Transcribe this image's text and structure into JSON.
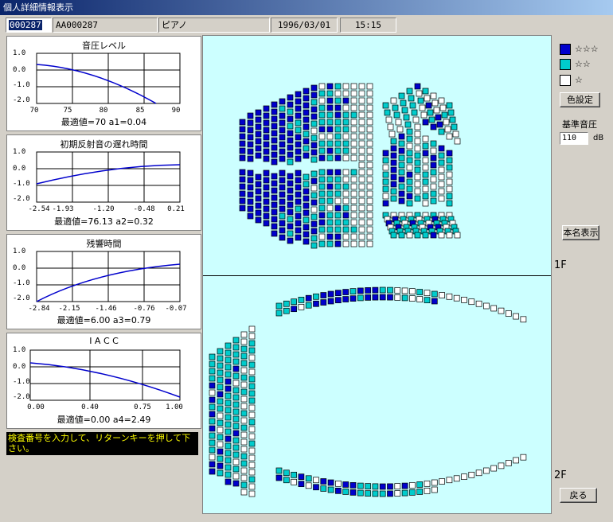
{
  "window": {
    "title": "個人詳細情報表示"
  },
  "header": {
    "exam_number": "000287",
    "id": "AA000287",
    "source": "ピアノ",
    "date": "1996/03/01",
    "time": "15:15"
  },
  "graphs": [
    {
      "title": "音圧レベル",
      "y_ticks": [
        "1.0",
        "0.0",
        "-1.0",
        "-2.0"
      ],
      "x_ticks": [
        "70",
        "75",
        "80",
        "85",
        "90"
      ],
      "footer": "最適値=70 a1=0.04"
    },
    {
      "title": "初期反射音の遅れ時間",
      "y_ticks": [
        "1.0",
        "0.0",
        "-1.0",
        "-2.0"
      ],
      "x_ticks": [
        "-2.54",
        "-1.93",
        "-1.20",
        "-0.48",
        "0.21"
      ],
      "footer": "最適値=76.13 a2=0.32"
    },
    {
      "title": "残響時間",
      "y_ticks": [
        "1.0",
        "0.0",
        "-1.0",
        "-2.0"
      ],
      "x_ticks": [
        "-2.84",
        "-2.15",
        "-1.46",
        "-0.76",
        "-0.07"
      ],
      "footer": "最適値=6.00 a3=0.79"
    },
    {
      "title": "I A C C",
      "y_ticks": [
        "1.0",
        "0.0",
        "-1.0",
        "-2.0"
      ],
      "x_ticks": [
        "0.00",
        "0.40",
        "0.75",
        "1.00"
      ],
      "footer": "最適値=0.00 a4=2.49"
    }
  ],
  "message": "検査番号を入力して、リターンキーを押して下さい。",
  "floors": {
    "first": "1F",
    "second": "2F"
  },
  "legend": [
    {
      "label": "☆☆☆",
      "color": "#0000cc"
    },
    {
      "label": "☆☆",
      "color": "#00cccc"
    },
    {
      "label": "☆",
      "color": "#ffffff"
    }
  ],
  "buttons": {
    "color_settings": "色設定",
    "real_name": "本名表示",
    "back": "戻る"
  },
  "reference_pressure": {
    "label": "基準音圧",
    "value": "110",
    "unit": "dB"
  }
}
